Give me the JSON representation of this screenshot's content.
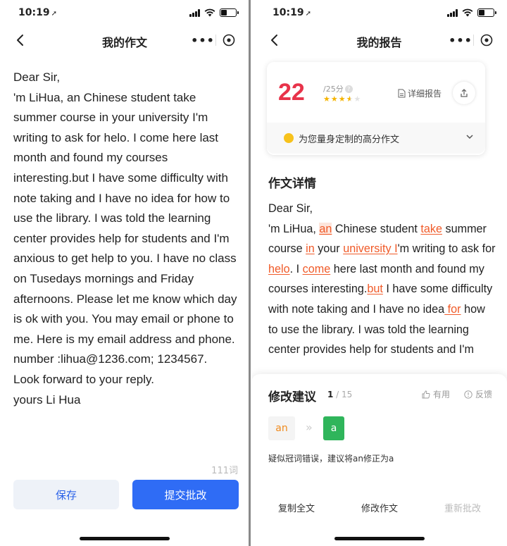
{
  "left": {
    "status_time": "10:19",
    "nav_title": "我的作文",
    "essay_paragraphs": [
      " Dear Sir,",
      "'m LiHua, an Chinese student take summer course in your university I'm writing to ask for helo. I come here last month and found my courses interesting.but I have some difficulty with note taking and I have no idea for how to use the library. I was told the learning center provides help for students and I'm anxious to get help to you. I have no class on Tusedays mornings and Friday afternoons. Please let me know which day is ok with you. You may email or phone to me. Here is my email address and phone. number :lihua@1236.com; 1234567.",
      "Look forward to your reply.",
      "yours Li Hua"
    ],
    "word_count": "111词",
    "save_label": "保存",
    "submit_label": "提交批改"
  },
  "right": {
    "status_time": "10:19",
    "nav_title": "我的报告",
    "score": "22",
    "score_total": "/25分",
    "rating_stars": 3.5,
    "rating_max": 5,
    "detail_report_label": "详细报告",
    "custom_essay_label": "为您量身定制的高分作文",
    "section_title": "作文详情",
    "essay": {
      "greeting": "Dear Sir,",
      "segments": [
        {
          "t": "'m LiHua, "
        },
        {
          "t": "an",
          "e": "hl"
        },
        {
          "t": " Chinese student "
        },
        {
          "t": "take",
          "e": "u"
        },
        {
          "t": " summer course "
        },
        {
          "t": "in",
          "e": "u"
        },
        {
          "t": " your "
        },
        {
          "t": "university I",
          "e": "u"
        },
        {
          "t": "'m writing to ask for "
        },
        {
          "t": "helo",
          "e": "u"
        },
        {
          "t": ". I "
        },
        {
          "t": "come",
          "e": "u"
        },
        {
          "t": " here last month and found my courses interesting."
        },
        {
          "t": "but",
          "e": "u"
        },
        {
          "t": " I have some difficulty with note taking and I have no idea"
        },
        {
          "t": " for",
          "e": "u"
        },
        {
          "t": " how to use the library. I was told the learning center provides help for students and I'm"
        }
      ]
    },
    "suggestion": {
      "title": "修改建议",
      "current": "1",
      "separator": " / ",
      "total": "15",
      "useful_label": "有用",
      "report_label": "反馈",
      "original": "an",
      "arrow": "»",
      "replacement": "a",
      "description": "疑似冠词错误，建议将an修正为a"
    },
    "actions": {
      "copy": "复制全文",
      "edit": "修改作文",
      "recheck": "重新批改"
    }
  },
  "colors": {
    "primary": "#2f6cf5",
    "score_red": "#e8334a",
    "error_orange": "#f05a28",
    "star": "#f5b400",
    "green": "#2fb55b"
  }
}
